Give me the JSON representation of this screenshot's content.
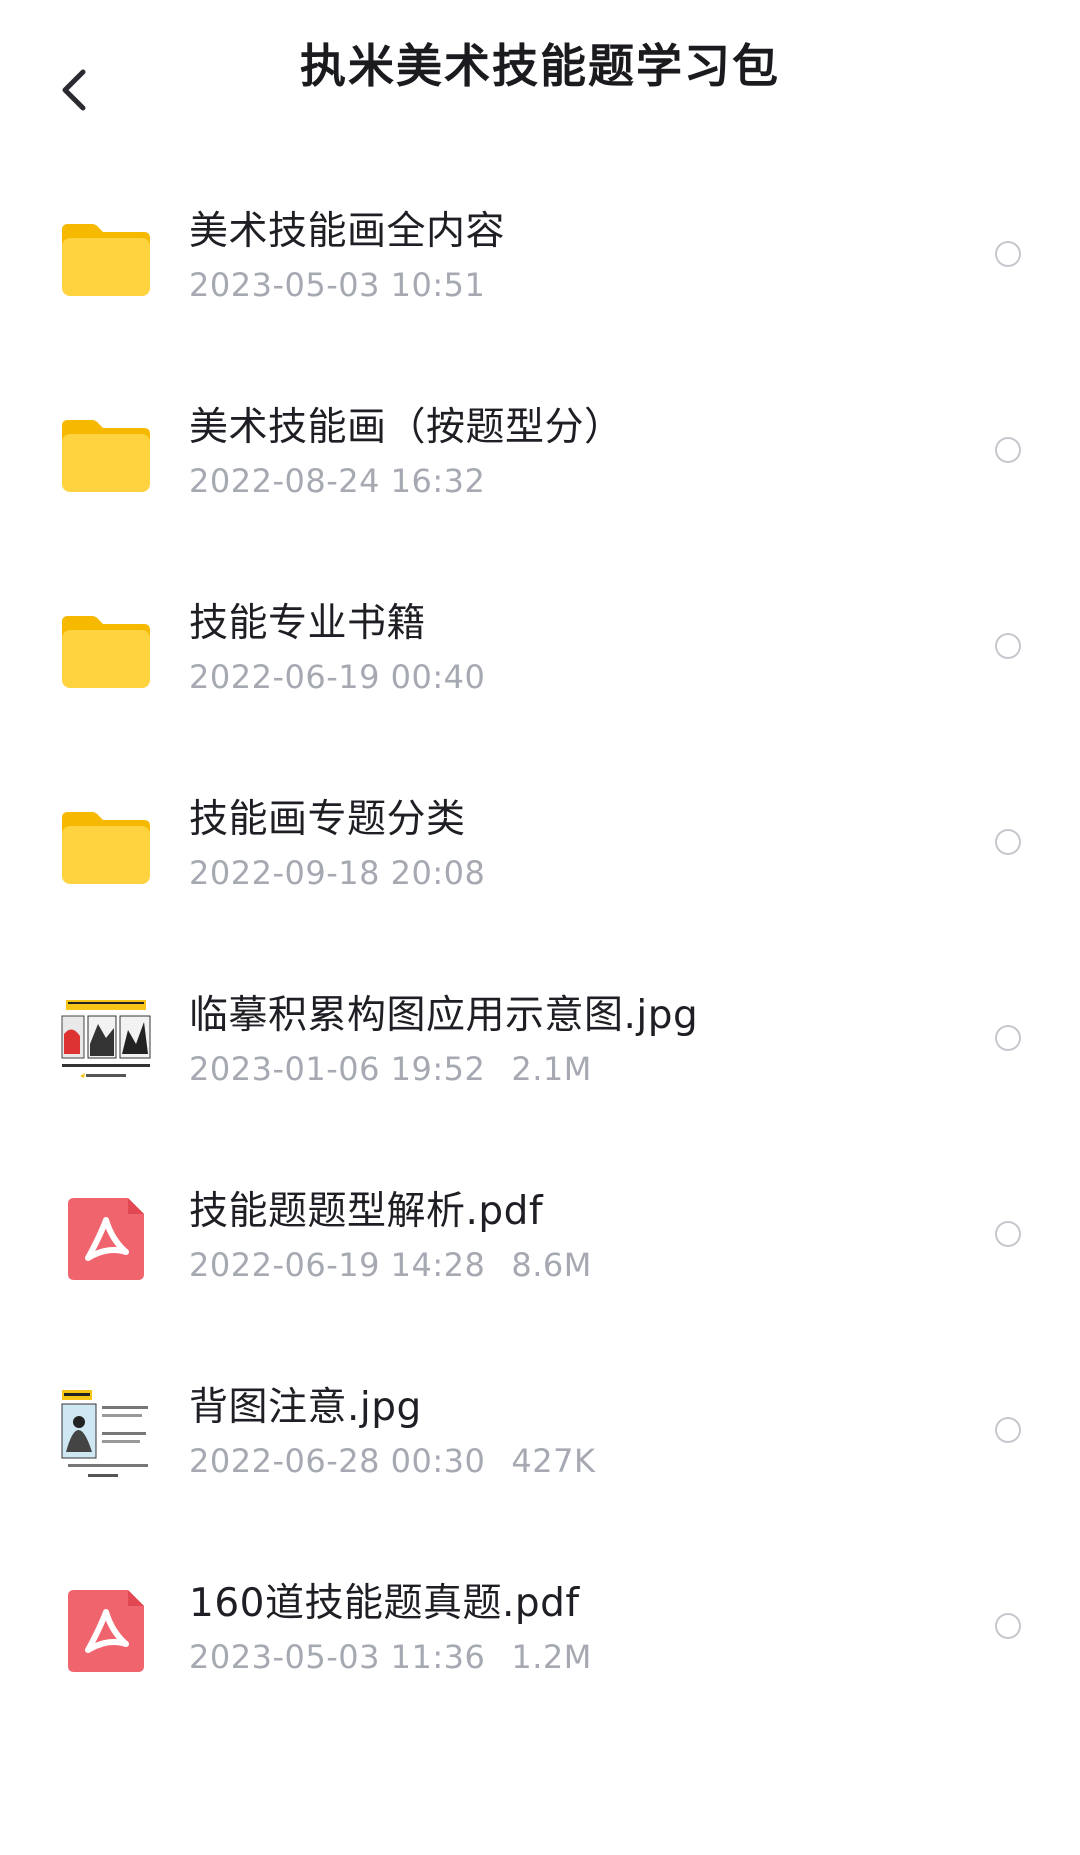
{
  "header": {
    "title": "执米美术技能题学习包"
  },
  "files": [
    {
      "type": "folder",
      "icon": "folder-icon",
      "name": "美术技能画全内容",
      "date": "2023-05-03 10:51",
      "size": ""
    },
    {
      "type": "folder",
      "icon": "folder-icon",
      "name": "美术技能画（按题型分）",
      "date": "2022-08-24 16:32",
      "size": ""
    },
    {
      "type": "folder",
      "icon": "folder-icon",
      "name": "技能专业书籍",
      "date": "2022-06-19 00:40",
      "size": ""
    },
    {
      "type": "folder",
      "icon": "folder-icon",
      "name": "技能画专题分类",
      "date": "2022-09-18 20:08",
      "size": ""
    },
    {
      "type": "image",
      "icon": "image-thumbnail",
      "name": "临摹积累构图应用示意图.jpg",
      "date": "2023-01-06 19:52",
      "size": "2.1M"
    },
    {
      "type": "pdf",
      "icon": "pdf-icon",
      "name": "技能题题型解析.pdf",
      "date": "2022-06-19 14:28",
      "size": "8.6M"
    },
    {
      "type": "image",
      "icon": "image-thumbnail",
      "name": "背图注意.jpg",
      "date": "2022-06-28 00:30",
      "size": "427K"
    },
    {
      "type": "pdf",
      "icon": "pdf-icon",
      "name": "160道技能题真题.pdf",
      "date": "2023-05-03 11:36",
      "size": "1.2M"
    }
  ],
  "colors": {
    "folder": "#ffd23f",
    "folder_dark": "#f6b900",
    "pdf": "#f0646e",
    "meta_text": "#a6a9b2",
    "radio_border": "#c6c8cd"
  }
}
